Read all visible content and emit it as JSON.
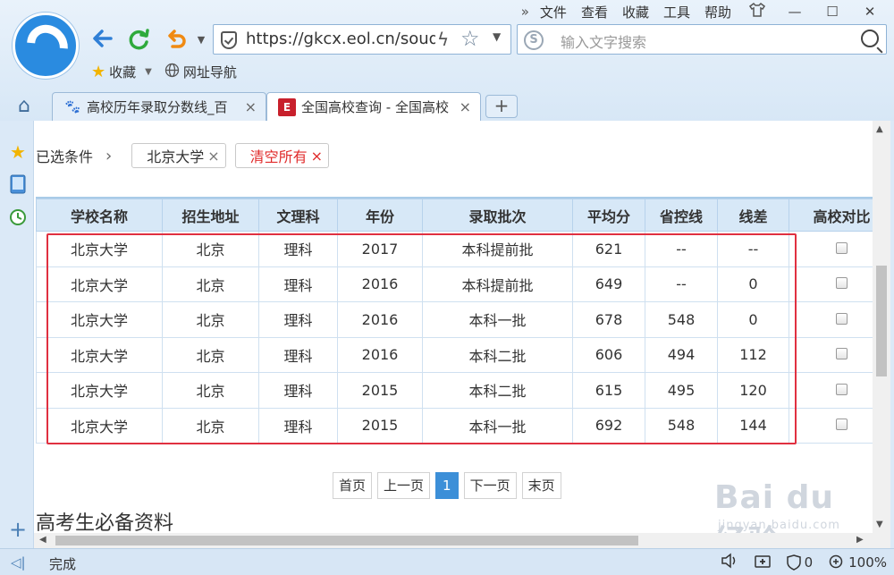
{
  "menu": {
    "items": [
      "文件",
      "查看",
      "收藏",
      "工具",
      "帮助"
    ],
    "more": "»",
    "shirt_icon": "shirt-icon",
    "win_minimize": "—",
    "win_maximize": "☐",
    "win_close": "✕"
  },
  "address_bar": {
    "url": "https://gkcx.eol.cn/soud"
  },
  "search": {
    "placeholder": "输入文字搜索"
  },
  "bookmarks": {
    "favorites": "收藏",
    "nav": "网址导航"
  },
  "tabs": [
    {
      "title": "高校历年录取分数线_百",
      "close": "×"
    },
    {
      "title": "全国高校查询 - 全国高校",
      "close": "×"
    }
  ],
  "new_tab": "+",
  "filters": {
    "label": "已选条件",
    "arrow": "›",
    "chips": [
      {
        "text": "北京大学",
        "x": "×"
      },
      {
        "text": "清空所有",
        "x": "×"
      }
    ]
  },
  "table": {
    "headers": [
      "学校名称",
      "招生地址",
      "文理科",
      "年份",
      "录取批次",
      "平均分",
      "省控线",
      "线差",
      "高校对比"
    ],
    "rows": [
      [
        "北京大学",
        "北京",
        "理科",
        "2017",
        "本科提前批",
        "621",
        "--",
        "--"
      ],
      [
        "北京大学",
        "北京",
        "理科",
        "2016",
        "本科提前批",
        "649",
        "--",
        "0"
      ],
      [
        "北京大学",
        "北京",
        "理科",
        "2016",
        "本科一批",
        "678",
        "548",
        "0"
      ],
      [
        "北京大学",
        "北京",
        "理科",
        "2016",
        "本科二批",
        "606",
        "494",
        "112"
      ],
      [
        "北京大学",
        "北京",
        "理科",
        "2015",
        "本科二批",
        "615",
        "495",
        "120"
      ],
      [
        "北京大学",
        "北京",
        "理科",
        "2015",
        "本科一批",
        "692",
        "548",
        "144"
      ]
    ]
  },
  "pager": {
    "first": "首页",
    "prev": "上一页",
    "current": "1",
    "next": "下一页",
    "last": "末页"
  },
  "section_title": "高考生必备资料",
  "watermark": {
    "brand": "Bai du 经验",
    "url": "jingyan.baidu.com"
  },
  "status": {
    "text": "完成",
    "zoom": "100%",
    "count": "0"
  },
  "colors": {
    "accent": "#3c8fd8",
    "highlight_box": "#e03040",
    "header_bg": "#d7e8f7",
    "clear_red": "#e02b2b"
  }
}
